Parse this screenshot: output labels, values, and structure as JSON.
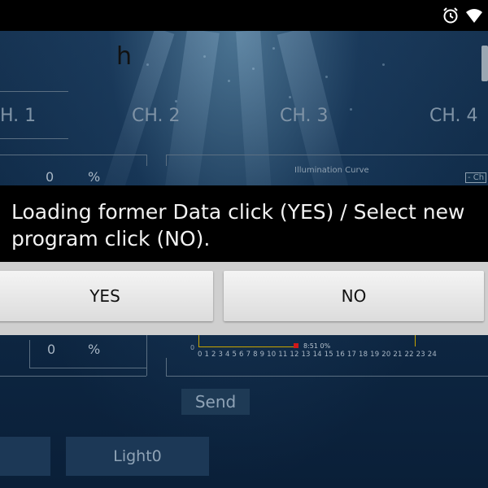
{
  "status_bar": {
    "alarm_icon": "alarm-clock-icon",
    "signal_icon": "wifi-signal-icon"
  },
  "header": {
    "title_fragment": "h"
  },
  "channels": [
    "H. 1",
    "CH. 2",
    "CH. 3",
    "CH. 4"
  ],
  "channel_panel": {
    "top_value": "0",
    "top_unit": "%",
    "bottom_value": "0",
    "bottom_unit": "%",
    "chart_title": "Illumination Curve",
    "chart_corner_label": "- Ch",
    "chart_zero": "0",
    "chart_marker_label": "8:51 0%",
    "x_ticks": "0 1 2 3 4 5 6 7 8 9 10 11 12 13 14 15 16 17 18 19 20 21 22 23 24"
  },
  "actions": {
    "send_label": "Send",
    "light_button_label": "Light0"
  },
  "dialog": {
    "message": "Loading former Data click (YES) / Select new program click (NO).",
    "yes_label": "YES",
    "no_label": "NO"
  }
}
